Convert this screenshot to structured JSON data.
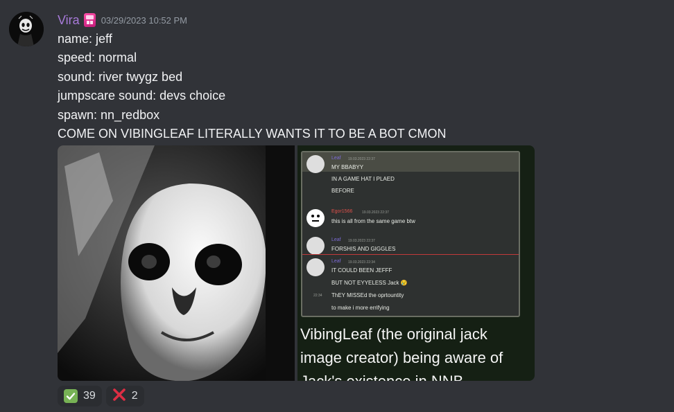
{
  "message": {
    "author": "Vira",
    "timestamp": "03/29/2023 10:52 PM",
    "role_badge_text": "ROLE",
    "lines": [
      "name: jeff",
      "speed: normal",
      "sound: river twygz bed",
      "jumpscare sound: devs choice",
      "spawn: nn_redbox",
      "COME ON VIBINGLEAF LITERALLY WANTS IT TO BE A BOT CMON"
    ]
  },
  "attachment_2": {
    "chat": [
      {
        "name": "Leaf",
        "time": "19.03.2023 22:37",
        "lines": [
          "MY BBABYY",
          "IN A GAME HAT I PLAED",
          "BEFORE"
        ]
      },
      {
        "name": "Egor1566",
        "time": "19.03.2023 22:37",
        "lines": [
          "this is all from the same game btw"
        ]
      },
      {
        "name": "Leaf",
        "time": "19.03.2023 22:37",
        "lines": [
          "FORSHIS AND GIGGLES"
        ]
      },
      {
        "name": "Leaf",
        "time": "19.03.2023 22:34",
        "lines": [
          "IT COULD BEEN JEFFF",
          "BUT NOT EYYELESS Jack 😢",
          "ThEY MISSEd the oprtountity",
          "to make i more errifying"
        ]
      },
      {
        "side_time": "22:34"
      }
    ],
    "caption": "VibingLeaf (the original jack image creator) being aware of Jack's existence in NNB"
  },
  "reactions": [
    {
      "emoji": "check-mark",
      "count": "39"
    },
    {
      "emoji": "cross-mark",
      "count": "2"
    }
  ],
  "colors": {
    "background": "#313338",
    "username": "#a77ad9",
    "timestamp": "#949ba4",
    "reaction_bg": "#2b2d31"
  }
}
